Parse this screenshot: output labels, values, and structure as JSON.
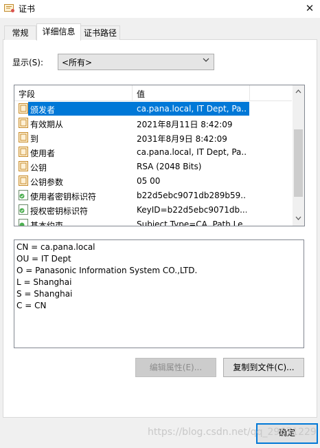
{
  "window": {
    "title": "证书",
    "close_glyph": "✕"
  },
  "tabs": [
    {
      "label": "常规",
      "active": false
    },
    {
      "label": "详细信息",
      "active": true
    },
    {
      "label": "证书路径",
      "active": false
    }
  ],
  "show": {
    "label": "显示(S):",
    "value": "<所有>"
  },
  "columns": {
    "field": "字段",
    "value": "值"
  },
  "rows": [
    {
      "field": "颁发者",
      "value": "ca.pana.local, IT Dept, Pa...",
      "icon": "cert-field-icon",
      "selected": true
    },
    {
      "field": "有效期从",
      "value": "2021年8月11日 8:42:09",
      "icon": "cert-field-icon"
    },
    {
      "field": "到",
      "value": "2031年8月9日 8:42:09",
      "icon": "cert-field-icon"
    },
    {
      "field": "使用者",
      "value": "ca.pana.local, IT Dept, Pa...",
      "icon": "cert-field-icon"
    },
    {
      "field": "公钥",
      "value": "RSA (2048 Bits)",
      "icon": "cert-field-icon"
    },
    {
      "field": "公钥参数",
      "value": "05 00",
      "icon": "cert-field-icon"
    },
    {
      "field": "使用者密钥标识符",
      "value": "b22d5ebc9071db289b59...",
      "icon": "cert-extension-icon"
    },
    {
      "field": "授权密钥标识符",
      "value": "KeyID=b22d5ebc9071db...",
      "icon": "cert-extension-icon"
    },
    {
      "field": "基本约束",
      "value": "Subject Type=CA, Path Le...",
      "icon": "cert-extension-icon"
    }
  ],
  "detail_lines": [
    "CN = ca.pana.local",
    "OU = IT Dept",
    "O = Panasonic Information System CO.,LTD.",
    "L = Shanghai",
    "S = Shanghai",
    "C = CN"
  ],
  "buttons": {
    "edit_properties": "编辑属性(E)...",
    "copy_to_file": "复制到文件(C)...",
    "ok": "确定"
  },
  "watermark": "https://blog.csdn.net/qq_29671229",
  "colors": {
    "selection": "#0078d7",
    "panel": "#ffffff",
    "window_bg": "#f0f0f0"
  }
}
